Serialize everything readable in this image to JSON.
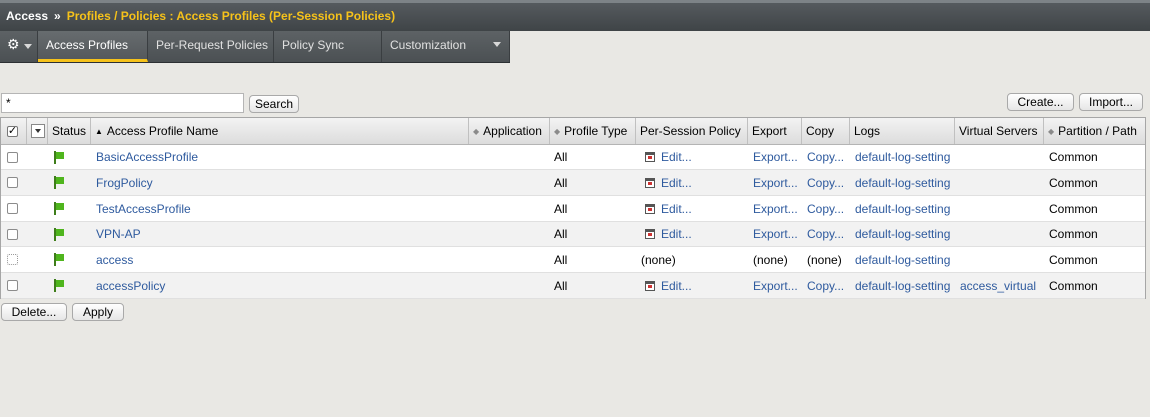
{
  "breadcrumb": {
    "root": "Access",
    "separator": "»",
    "current": "Profiles / Policies : Access Profiles (Per-Session Policies)"
  },
  "tabs": [
    {
      "label": "Access Profiles",
      "active": true
    },
    {
      "label": "Per-Request Policies",
      "active": false
    },
    {
      "label": "Policy Sync",
      "active": false
    },
    {
      "label": "Customization",
      "active": false,
      "has_menu": true
    }
  ],
  "search": {
    "value": "*",
    "button_label": "Search"
  },
  "actions": {
    "create_label": "Create...",
    "import_label": "Import..."
  },
  "table": {
    "columns": {
      "status": "Status",
      "name": "Access Profile Name",
      "application": "Application",
      "profile_type": "Profile Type",
      "per_session_policy": "Per-Session Policy",
      "export": "Export",
      "copy": "Copy",
      "logs": "Logs",
      "virtual_servers": "Virtual Servers",
      "partition": "Partition / Path"
    },
    "rows": [
      {
        "name": "BasicAccessProfile",
        "application": "",
        "profile_type": "All",
        "policy": "Edit...",
        "export": "Export...",
        "copy": "Copy...",
        "logs": "default-log-setting",
        "virtual_servers": "",
        "partition": "Common"
      },
      {
        "name": "FrogPolicy",
        "application": "",
        "profile_type": "All",
        "policy": "Edit...",
        "export": "Export...",
        "copy": "Copy...",
        "logs": "default-log-setting",
        "virtual_servers": "",
        "partition": "Common"
      },
      {
        "name": "TestAccessProfile",
        "application": "",
        "profile_type": "All",
        "policy": "Edit...",
        "export": "Export...",
        "copy": "Copy...",
        "logs": "default-log-setting",
        "virtual_servers": "",
        "partition": "Common"
      },
      {
        "name": "VPN-AP",
        "application": "",
        "profile_type": "All",
        "policy": "Edit...",
        "export": "Export...",
        "copy": "Copy...",
        "logs": "default-log-setting",
        "virtual_servers": "",
        "partition": "Common"
      },
      {
        "name": "access",
        "application": "",
        "profile_type": "All",
        "policy": "(none)",
        "export": "(none)",
        "copy": "(none)",
        "logs": "default-log-setting",
        "virtual_servers": "",
        "partition": "Common"
      },
      {
        "name": "accessPolicy",
        "application": "",
        "profile_type": "All",
        "policy": "Edit...",
        "export": "Export...",
        "copy": "Copy...",
        "logs": "default-log-setting",
        "virtual_servers": "access_virtual",
        "partition": "Common"
      }
    ]
  },
  "footer": {
    "delete_label": "Delete...",
    "apply_label": "Apply"
  },
  "colors": {
    "accent": "#f6c21a",
    "link": "#2e5a9e",
    "status_green": "#4fb51d"
  }
}
